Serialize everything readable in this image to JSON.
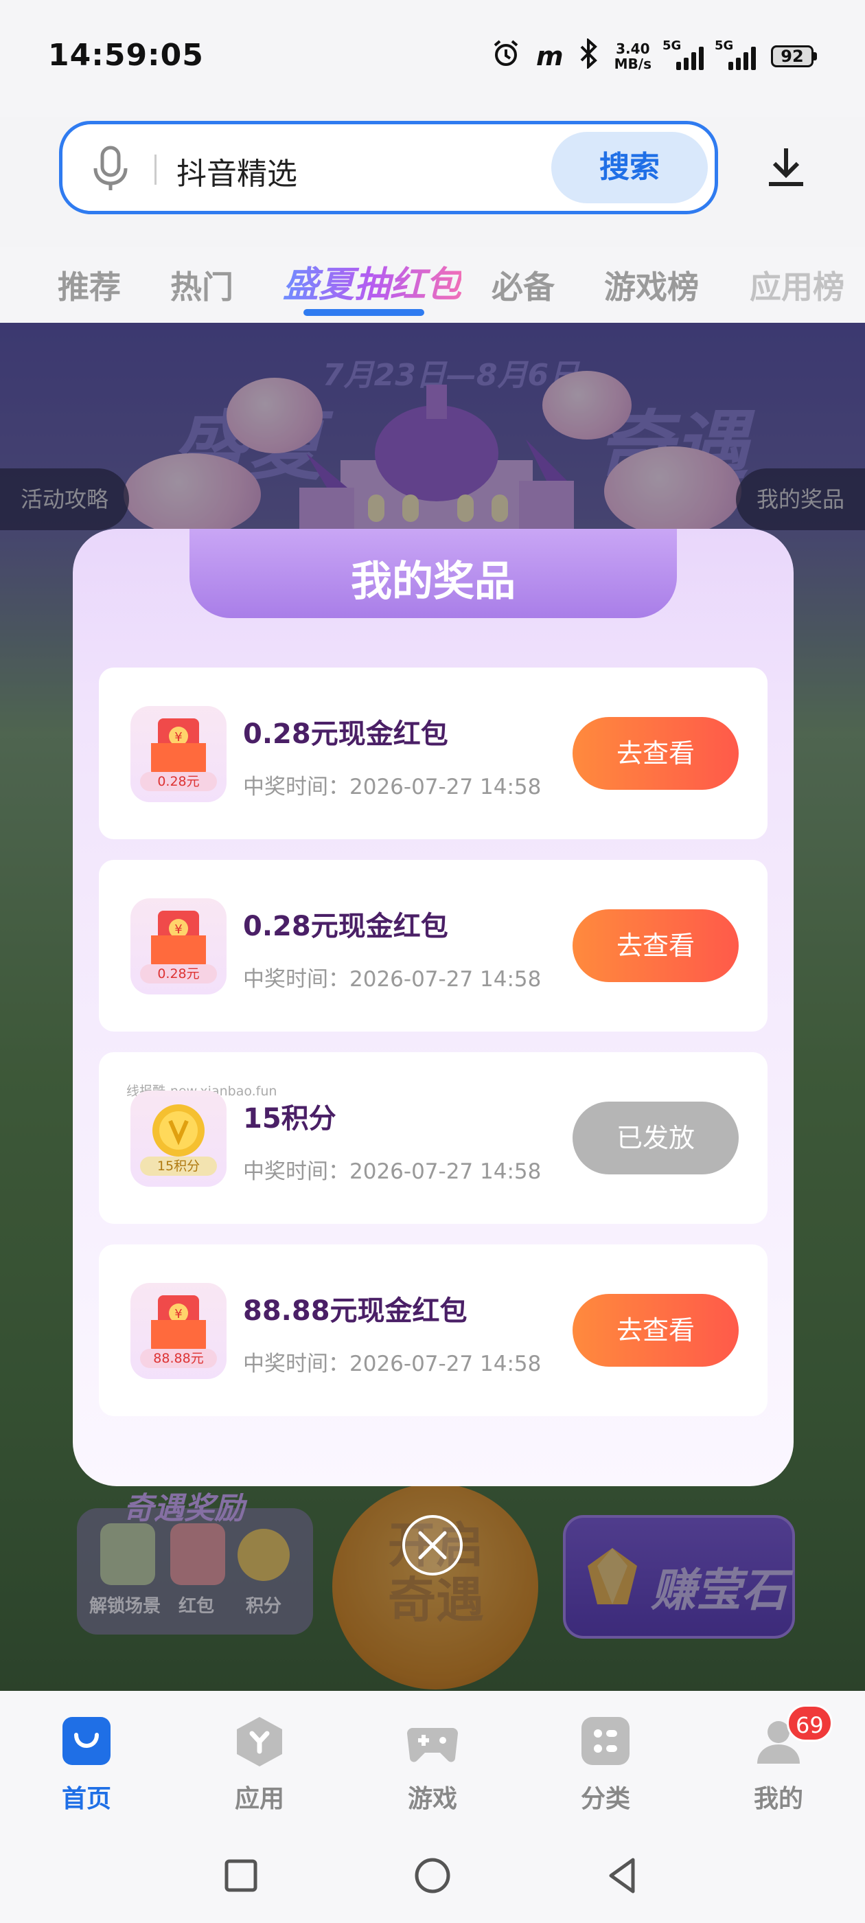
{
  "status_bar": {
    "time": "14:59:05",
    "net_speed_value": "3.40",
    "net_speed_unit": "MB/s",
    "sim1": "5G",
    "sim2": "5G",
    "battery": "92"
  },
  "search": {
    "text": "抖音精选",
    "button": "搜索"
  },
  "tabs": [
    "推荐",
    "热门",
    "盛夏抽红包",
    "必备",
    "游戏榜",
    "应用榜"
  ],
  "banner": {
    "dates": "7月23日—8月6日",
    "title_left": "盛夏",
    "title_right": "奇遇",
    "left_pill": "活动攻略",
    "right_pill": "我的奖品"
  },
  "modal": {
    "title": "我的奖品",
    "watermark": "线报酷-new.xianbao.fun",
    "prizes": [
      {
        "name": "0.28元现金红包",
        "time": "中奖时间：2026-07-27 14:58",
        "tag": "0.28元",
        "button": "去查看",
        "status": "active",
        "icon": "red-envelope-icon"
      },
      {
        "name": "0.28元现金红包",
        "time": "中奖时间：2026-07-27 14:58",
        "tag": "0.28元",
        "button": "去查看",
        "status": "active",
        "icon": "red-envelope-icon"
      },
      {
        "name": "15积分",
        "time": "中奖时间：2026-07-27 14:58",
        "tag": "15积分",
        "button": "已发放",
        "status": "disabled",
        "icon": "coin-icon"
      },
      {
        "name": "88.88元现金红包",
        "time": "中奖时间：2026-07-27 14:58",
        "tag": "88.88元",
        "button": "去查看",
        "status": "active",
        "icon": "red-envelope-icon"
      }
    ]
  },
  "scene_bottom": {
    "reward_title": "奇遇奖励",
    "reward_items": [
      "解锁场景",
      "红包",
      "积分"
    ],
    "start_text": "开启奇遇",
    "gem_text": "赚莹石"
  },
  "bottom_nav": {
    "items": [
      "首页",
      "应用",
      "游戏",
      "分类",
      "我的"
    ],
    "badge": "69"
  },
  "colors": {
    "accent": "#2f7bf0",
    "button_orange": "#ff6a45",
    "button_disabled": "#b5b5b5",
    "modal_header": "#b58cef"
  }
}
